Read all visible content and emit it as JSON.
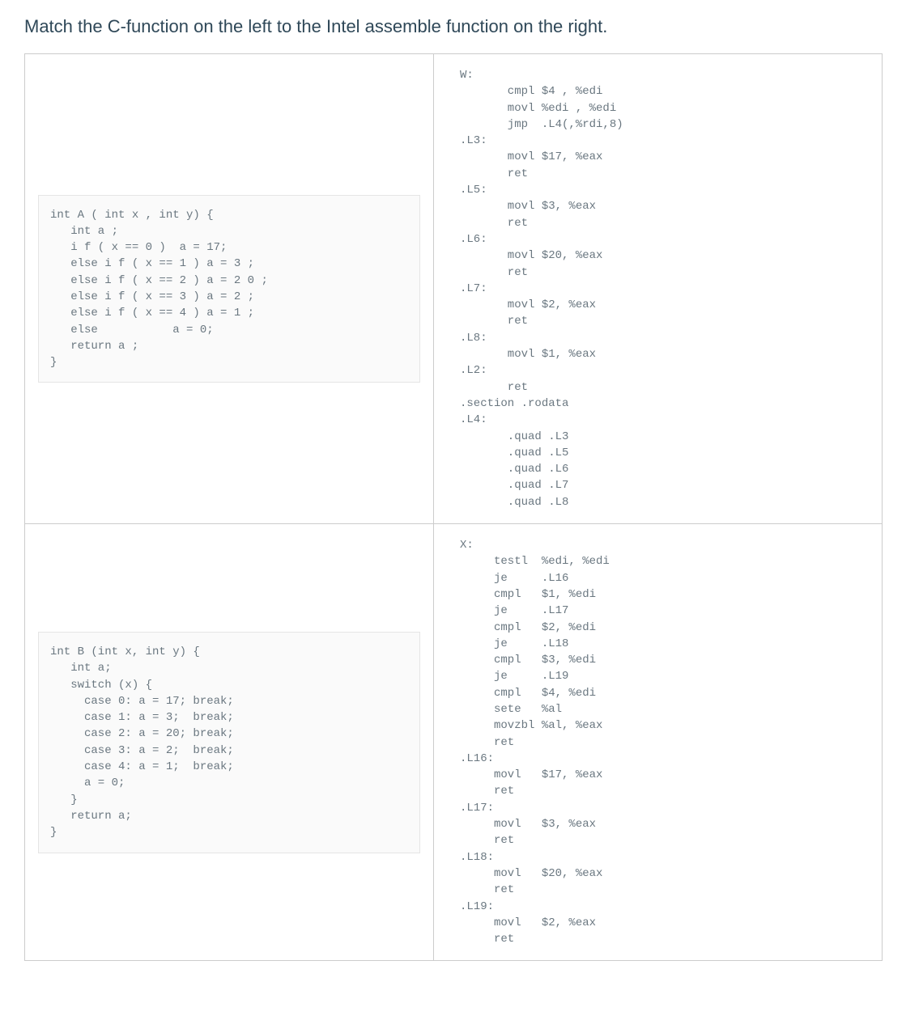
{
  "heading": "Match the C-function on the left to the Intel assemble function on the right.",
  "rows": [
    {
      "c_code": "int A ( int x , int y) {\n   int a ;\n   i f ( x == 0 )  a = 17;\n   else i f ( x == 1 ) a = 3 ;\n   else i f ( x == 2 ) a = 2 0 ;\n   else i f ( x == 3 ) a = 2 ;\n   else i f ( x == 4 ) a = 1 ;\n   else           a = 0;\n   return a ;\n}",
      "asm_code": "W:\n       cmpl $4 , %edi\n       movl %edi , %edi\n       jmp  .L4(,%rdi,8)\n.L3:\n       movl $17, %eax\n       ret\n.L5:\n       movl $3, %eax\n       ret\n.L6:\n       movl $20, %eax\n       ret\n.L7:\n       movl $2, %eax\n       ret\n.L8:\n       movl $1, %eax\n.L2:\n       ret\n.section .rodata\n.L4:\n       .quad .L3\n       .quad .L5\n       .quad .L6\n       .quad .L7\n       .quad .L8"
    },
    {
      "c_code": "int B (int x, int y) {\n   int a;\n   switch (x) {\n     case 0: a = 17; break;\n     case 1: a = 3;  break;\n     case 2: a = 20; break;\n     case 3: a = 2;  break;\n     case 4: a = 1;  break;\n     a = 0;\n   }\n   return a;\n}",
      "asm_code": "X:\n     testl  %edi, %edi\n     je     .L16\n     cmpl   $1, %edi\n     je     .L17\n     cmpl   $2, %edi\n     je     .L18\n     cmpl   $3, %edi\n     je     .L19\n     cmpl   $4, %edi\n     sete   %al\n     movzbl %al, %eax\n     ret\n.L16:\n     movl   $17, %eax\n     ret\n.L17:\n     movl   $3, %eax\n     ret\n.L18:\n     movl   $20, %eax\n     ret\n.L19:\n     movl   $2, %eax\n     ret"
    }
  ]
}
